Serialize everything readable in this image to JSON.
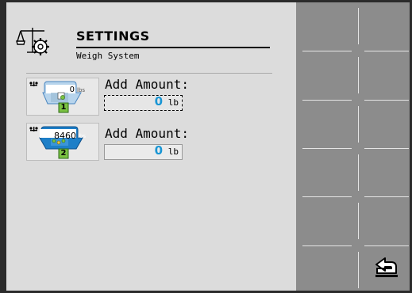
{
  "header": {
    "title": "SETTINGS",
    "subtitle": "Weigh System"
  },
  "rows": [
    {
      "bin_number": "1",
      "bin_weight": "0",
      "bin_unit": "lbs",
      "label": "Add Amount:",
      "amount": "0",
      "unit": "lb",
      "focused": true
    },
    {
      "bin_number": "2",
      "bin_weight": "8460",
      "bin_unit": "lbs",
      "label": "Add Amount:",
      "amount": "0",
      "unit": "lb",
      "focused": false
    }
  ],
  "softkeys": {
    "count": 6,
    "back_icon": "return-arrow-icon"
  },
  "colors": {
    "accent_value": "#1a96d4",
    "bin_blue": "#1e7fc8",
    "badge_green": "#7bc242",
    "panel": "#dcdcdc",
    "softkey_panel": "#8c8c8c"
  }
}
